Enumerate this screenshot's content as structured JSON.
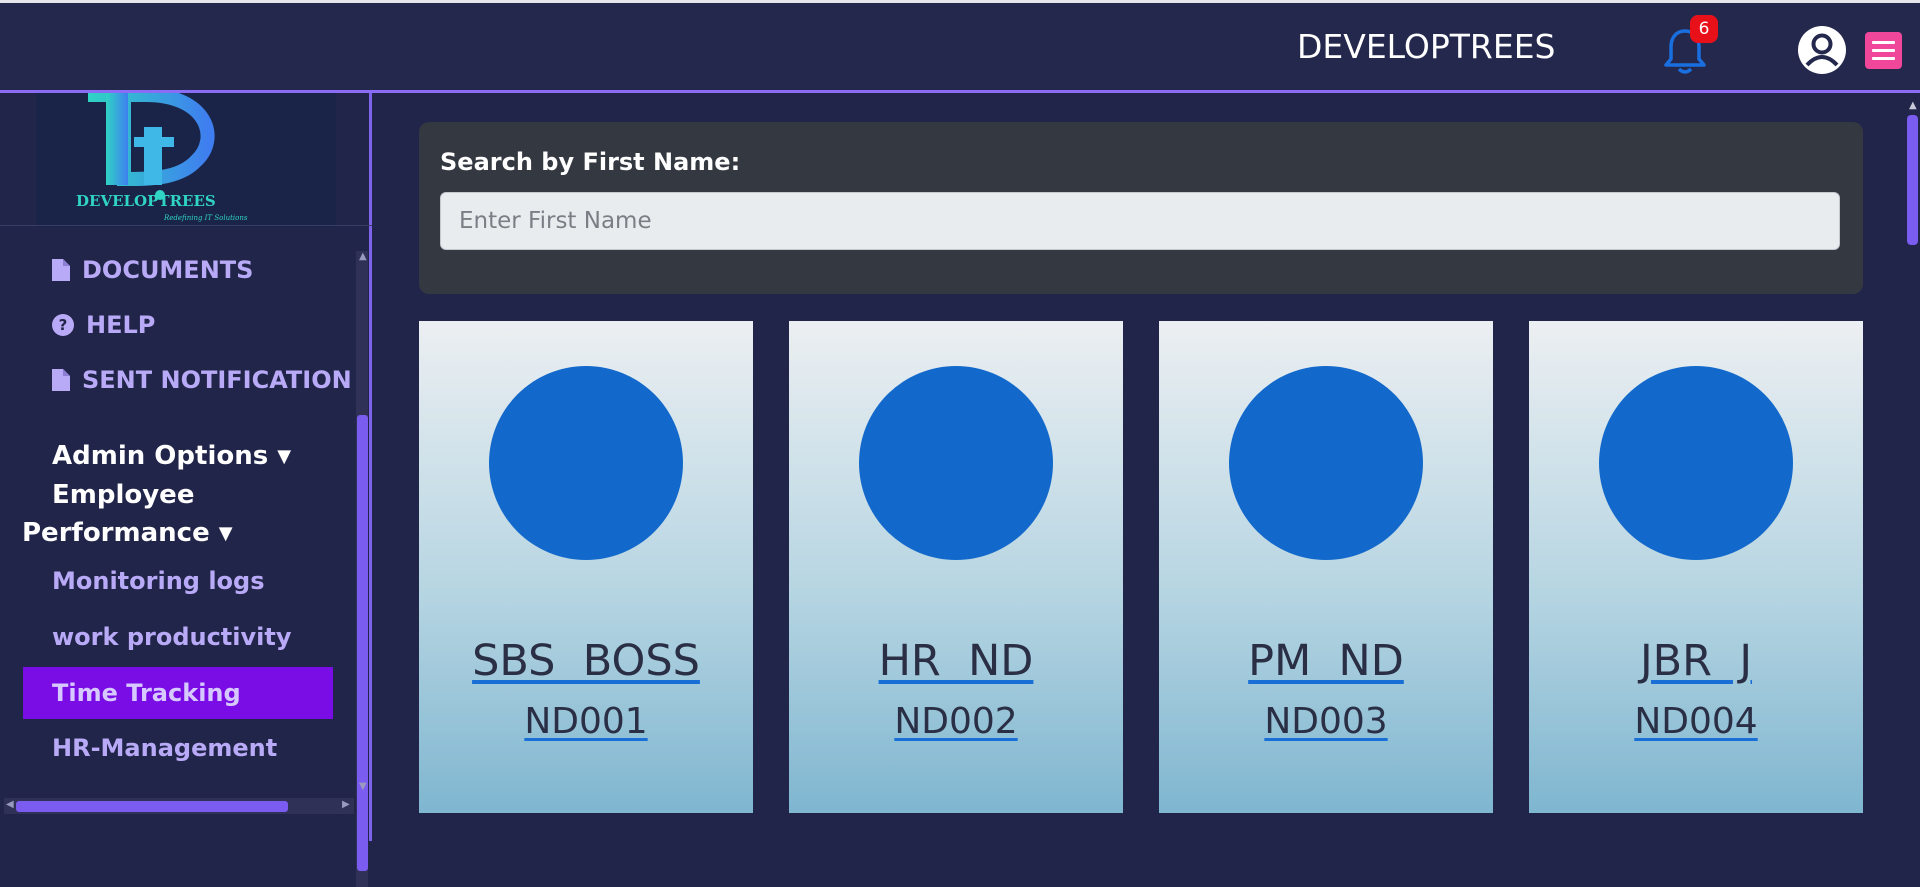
{
  "header": {
    "title": "DEVELOPTREES",
    "notification_count": "6"
  },
  "sidebar": {
    "logo": {
      "text": "DEVELOPTREES",
      "tagline": "Redefining IT Solutions"
    },
    "items": [
      {
        "label": "DOCUMENTS",
        "icon": "document-icon"
      },
      {
        "label": "HELP",
        "icon": "help-icon"
      },
      {
        "label": "SENT NOTIFICATION",
        "icon": "document-icon"
      }
    ],
    "admin_options": "Admin Options",
    "employee_performance_line1": "Employee",
    "employee_performance_line2": "Performance",
    "sub_items": [
      "Monitoring logs",
      "work productivity",
      "Time Tracking",
      "HR-Management"
    ],
    "active_item": "Time Tracking"
  },
  "search": {
    "label": "Search by First Name:",
    "placeholder": "Enter First Name",
    "value": ""
  },
  "employees": [
    {
      "name": "SBS  BOSS",
      "id": "ND001"
    },
    {
      "name": "HR  ND",
      "id": "ND002"
    },
    {
      "name": "PM  ND",
      "id": "ND003"
    },
    {
      "name": "JBR  J",
      "id": "ND004"
    }
  ],
  "colors": {
    "background": "#22254a",
    "accent": "#7a0ce6",
    "avatar": "#1369cb",
    "badge": "#e8111a",
    "menu_button": "#f0479a"
  }
}
